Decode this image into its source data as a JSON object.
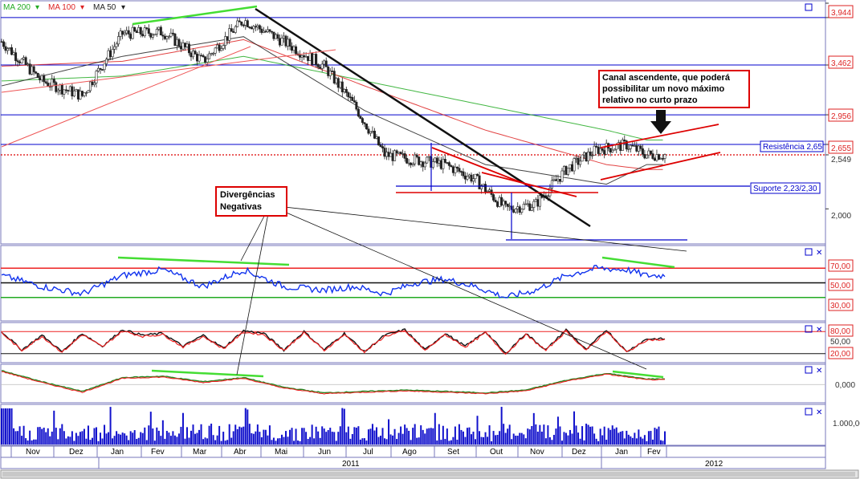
{
  "legend": {
    "ma200": "MA 200",
    "ma100": "MA 100",
    "ma50": "MA 50",
    "color_ma200": "#22aa22",
    "color_ma100": "#dd2222",
    "color_ma50": "#222222"
  },
  "colors": {
    "support_resistance": "#0000cc",
    "annotation_red": "#dd0000",
    "divergence_green": "#44dd33",
    "rsi_line": "#1133ee",
    "stoch_k": "#111111",
    "stoch_d": "#ee2222",
    "macd": "#228822",
    "macd_signal": "#ee2222",
    "volume": "#1111cc"
  },
  "annotations": {
    "channel_note": [
      "Canal ascendente, que poderá",
      "possibilitar um novo máximo",
      "relativo no curto prazo"
    ],
    "divergence_note": [
      "Divergências",
      "Negativas"
    ],
    "resistance_label": "Resistência 2,65",
    "support_label": "Suporte 2,23/2,30"
  },
  "price_axis": {
    "labels": [
      "3,944",
      "3,462",
      "2,956",
      "2,655",
      "2,549",
      "2,000"
    ],
    "label_values": [
      3.944,
      3.462,
      2.956,
      2.655,
      2.549,
      2.0
    ],
    "highlighted": [
      "3,944",
      "3,462",
      "2,956",
      "2,655"
    ],
    "ylim": [
      1.66,
      4.09
    ]
  },
  "rsi_axis": {
    "labels": [
      "70,00",
      "50,00",
      "30,00"
    ],
    "values": [
      70,
      50,
      30
    ]
  },
  "stoch_axis": {
    "labels": [
      "80,00",
      "50,00",
      "20,00"
    ],
    "values": [
      80,
      50,
      20
    ]
  },
  "macd_axis": {
    "labels": [
      "0,000"
    ]
  },
  "volume_axis": {
    "labels": [
      "1.000,00"
    ]
  },
  "time_axis": {
    "months": [
      "Nov",
      "Dez",
      "Jan",
      "Fev",
      "Mar",
      "Abr",
      "Mai",
      "Jun",
      "Jul",
      "Ago",
      "Set",
      "Out",
      "Nov",
      "Dez",
      "Jan",
      "Fev"
    ],
    "years": [
      "2011",
      "2012"
    ]
  },
  "chart_data": [
    {
      "type": "line",
      "title": "",
      "description_series": "daily price (candlesticks) with moving averages",
      "x_unit": "trading day index (Nov 2010 – Feb 2012)",
      "series": [
        {
          "name": "price",
          "x": [
            0,
            20,
            40,
            60,
            80,
            100,
            120,
            140,
            160,
            175,
            190,
            205,
            220,
            235,
            250,
            265,
            280,
            295,
            310,
            320
          ],
          "values": [
            3.7,
            3.3,
            3.15,
            3.78,
            3.8,
            3.5,
            3.92,
            3.7,
            3.45,
            3.05,
            2.55,
            2.5,
            2.45,
            2.3,
            2.0,
            2.05,
            2.4,
            2.6,
            2.65,
            2.55
          ]
        },
        {
          "name": "MA 200",
          "x": [
            0,
            60,
            120,
            180,
            240,
            300,
            320
          ],
          "values": [
            3.3,
            3.35,
            3.55,
            3.3,
            3.05,
            2.8,
            2.7
          ]
        },
        {
          "name": "MA 100",
          "x": [
            0,
            60,
            120,
            180,
            240,
            300,
            320
          ],
          "values": [
            3.45,
            3.5,
            3.72,
            3.25,
            2.8,
            2.45,
            2.4
          ]
        },
        {
          "name": "MA 50",
          "x": [
            0,
            60,
            120,
            180,
            240,
            300,
            320
          ],
          "values": [
            3.25,
            3.55,
            3.75,
            3.0,
            2.45,
            2.25,
            2.45
          ]
        }
      ],
      "levels": {
        "resistance": 2.65,
        "support": [
          2.23,
          2.3
        ]
      },
      "ylim": [
        1.66,
        4.09
      ]
    },
    {
      "type": "line",
      "title": "",
      "series": [
        {
          "name": "RSI",
          "x": [
            0,
            20,
            40,
            60,
            80,
            100,
            120,
            140,
            160,
            175,
            190,
            205,
            220,
            235,
            250,
            265,
            280,
            295,
            310,
            320
          ],
          "values": [
            60,
            45,
            35,
            60,
            68,
            45,
            68,
            45,
            40,
            45,
            35,
            50,
            55,
            45,
            30,
            40,
            60,
            70,
            68,
            60
          ]
        }
      ],
      "levels": [
        70,
        50,
        30
      ],
      "ylim": [
        0,
        100
      ]
    },
    {
      "type": "line",
      "title": "",
      "series": [
        {
          "name": "%K",
          "x": [
            0,
            10,
            20,
            30,
            40,
            50,
            60,
            70,
            80,
            90,
            100,
            110,
            120,
            130,
            140,
            150,
            160,
            170,
            180,
            190,
            200,
            210,
            220,
            230,
            240,
            250,
            260,
            270,
            280,
            290,
            300,
            310,
            320
          ],
          "values": [
            80,
            30,
            70,
            25,
            75,
            40,
            85,
            70,
            75,
            40,
            70,
            35,
            82,
            75,
            30,
            80,
            30,
            75,
            25,
            70,
            85,
            30,
            75,
            40,
            80,
            20,
            75,
            30,
            85,
            30,
            85,
            25,
            60
          ]
        }
      ],
      "levels": [
        80,
        50,
        20
      ],
      "ylim": [
        0,
        100
      ]
    },
    {
      "type": "line",
      "title": "",
      "series": [
        {
          "name": "MACD",
          "x": [
            0,
            20,
            40,
            60,
            80,
            100,
            120,
            140,
            160,
            180,
            200,
            220,
            240,
            260,
            280,
            300,
            320
          ],
          "values": [
            0.1,
            0.02,
            -0.05,
            0.05,
            0.06,
            0.02,
            0.05,
            -0.02,
            -0.06,
            -0.05,
            -0.04,
            -0.05,
            -0.06,
            -0.04,
            0.03,
            0.08,
            0.04
          ]
        }
      ],
      "ylim": [
        -0.12,
        0.14
      ]
    },
    {
      "type": "bar",
      "title": "",
      "series": [
        {
          "name": "Volume",
          "values": []
        }
      ],
      "note": "daily volume bars"
    }
  ]
}
